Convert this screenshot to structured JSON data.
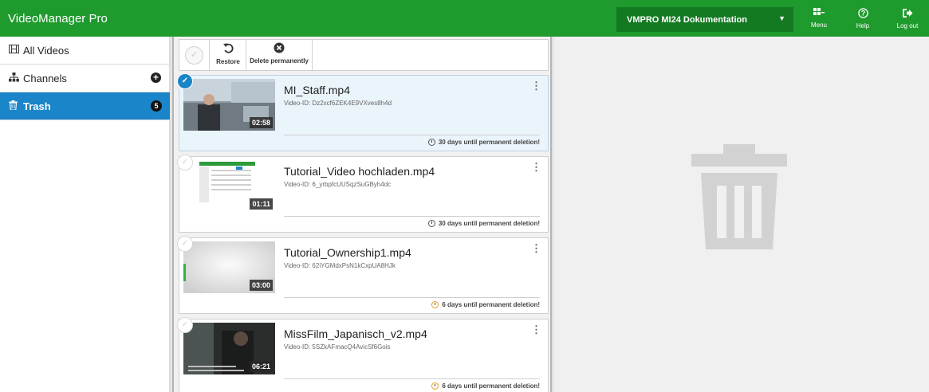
{
  "app": {
    "title": "VideoManager Pro"
  },
  "header": {
    "account": "VMPRO MI24 Dokumentation",
    "menu_label": "Menu",
    "help_label": "Help",
    "logout_label": "Log out"
  },
  "sidebar": {
    "items": [
      {
        "label": "All Videos",
        "icon": "film-icon"
      },
      {
        "label": "Channels",
        "icon": "sitemap-icon"
      },
      {
        "label": "Trash",
        "icon": "trash-icon",
        "count": "5",
        "active": true
      }
    ]
  },
  "toolbar": {
    "restore_label": "Restore",
    "delete_label": "Delete permanently"
  },
  "videos": [
    {
      "title": "MI_Staff.mp4",
      "video_id": "Video-ID: Dz2xcf6ZEK4E9VXves8h4d",
      "duration": "02:58",
      "deletion": "30 days until permanent deletion!",
      "selected": true
    },
    {
      "title": "Tutorial_Video hochladen.mp4",
      "video_id": "Video-ID: 6_yrbpfcUUSqzSuGByh4dc",
      "duration": "01:11",
      "deletion": "30 days until permanent deletion!",
      "selected": false
    },
    {
      "title": "Tutorial_Ownership1.mp4",
      "video_id": "Video-ID: 62iYGMdxPsN1kCxpUA8HJk",
      "duration": "03:00",
      "deletion": "6 days until permanent deletion!",
      "selected": false
    },
    {
      "title": "MissFilm_Japanisch_v2.mp4",
      "video_id": "Video-ID: 5SZkAFmacQ4AvicSf6Gois",
      "duration": "06:21",
      "deletion": "6 days until permanent deletion!",
      "selected": false
    }
  ],
  "colors": {
    "brand_green": "#1f9a2d",
    "active_blue": "#1a85c8",
    "warning_orange": "#e69b1c"
  }
}
